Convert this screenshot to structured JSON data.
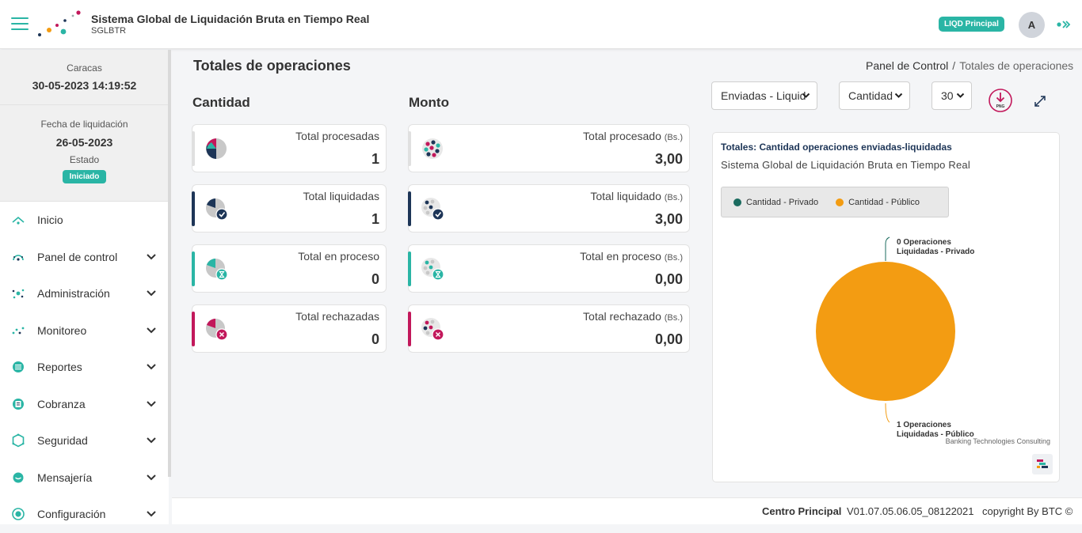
{
  "header": {
    "title": "Sistema Global de Liquidación Bruta en Tiempo Real",
    "subtitle": "SGLBTR",
    "badge": "LIQD Principal",
    "avatar_initial": "A"
  },
  "sidebar": {
    "city": "Caracas",
    "datetime": "30-05-2023 14:19:52",
    "liq_label": "Fecha de liquidación",
    "liq_date": "26-05-2023",
    "estado_label": "Estado",
    "estado_value": "Iniciado",
    "items": [
      {
        "label": "Inicio",
        "icon": "home-icon",
        "expandable": false
      },
      {
        "label": "Panel de control",
        "icon": "dashboard-icon",
        "expandable": true
      },
      {
        "label": "Administración",
        "icon": "network-icon",
        "expandable": true
      },
      {
        "label": "Monitoreo",
        "icon": "monitor-dots-icon",
        "expandable": true
      },
      {
        "label": "Reportes",
        "icon": "reports-icon",
        "expandable": true
      },
      {
        "label": "Cobranza",
        "icon": "billing-icon",
        "expandable": true
      },
      {
        "label": "Seguridad",
        "icon": "security-icon",
        "expandable": true
      },
      {
        "label": "Mensajería",
        "icon": "message-icon",
        "expandable": true
      },
      {
        "label": "Configuración",
        "icon": "settings-icon",
        "expandable": true
      }
    ]
  },
  "main": {
    "title": "Totales de operaciones",
    "breadcrumb": {
      "root": "Panel de Control",
      "separator": "/",
      "current": "Totales de operaciones"
    },
    "cantidad": {
      "title": "Cantidad",
      "cards": [
        {
          "label": "Total procesadas",
          "value": "1",
          "color": "#e0e0e0"
        },
        {
          "label": "Total liquidadas",
          "value": "1",
          "color": "#1d3557"
        },
        {
          "label": "Total en proceso",
          "value": "0",
          "color": "#2ab5a5"
        },
        {
          "label": "Total rechazadas",
          "value": "0",
          "color": "#c2185b"
        }
      ]
    },
    "monto": {
      "title": "Monto",
      "unit": "(Bs.)",
      "cards": [
        {
          "label": "Total procesado",
          "value": "3,00",
          "color": "#e0e0e0"
        },
        {
          "label": "Total liquidado",
          "value": "3,00",
          "color": "#1d3557"
        },
        {
          "label": "Total en proceso",
          "value": "0,00",
          "color": "#2ab5a5"
        },
        {
          "label": "Total rechazado",
          "value": "0,00",
          "color": "#c2185b"
        }
      ]
    },
    "filters": {
      "tipo": "Enviadas - Liquid",
      "metrica": "Cantidad",
      "dias": "30"
    }
  },
  "chart_data": {
    "type": "pie",
    "title": "Totales: Cantidad operaciones enviadas-liquidadas",
    "subtitle": "Sistema Global de Liquidación Bruta en Tiempo Real",
    "legend_position": "top-left",
    "series": [
      {
        "name": "Cantidad - Privado",
        "value": 0,
        "color": "#1b6b5f",
        "label_line1": "0 Operaciones",
        "label_line2": "Liquidadas - Privado"
      },
      {
        "name": "Cantidad - Público",
        "value": 1,
        "color": "#f39c12",
        "label_line1": "1 Operaciones",
        "label_line2": "Liquidadas - Público"
      }
    ],
    "credit": "Banking Technologies Consulting"
  },
  "footer": {
    "center": "Centro Principal",
    "version": "V01.07.05.06.05_08122021",
    "copyright": "copyright By BTC ©"
  }
}
